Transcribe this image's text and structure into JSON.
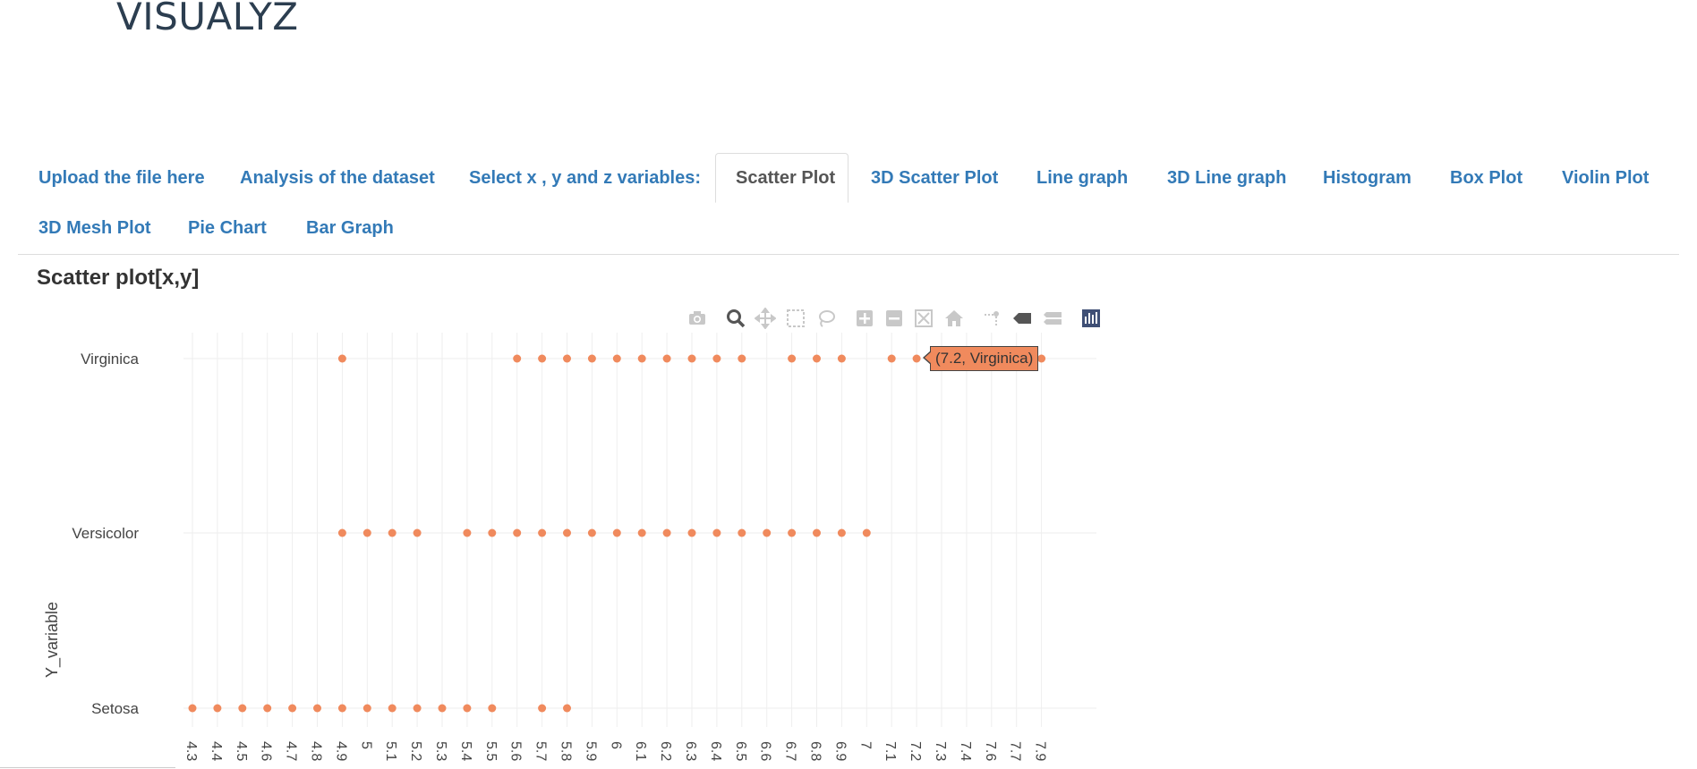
{
  "app": {
    "title": "VISUALYZ"
  },
  "tabs": [
    {
      "label": "Upload the file here",
      "active": false
    },
    {
      "label": "Analysis of the dataset",
      "active": false
    },
    {
      "label": "Select x , y and z variables:",
      "active": false
    },
    {
      "label": "Scatter Plot",
      "active": true
    },
    {
      "label": "3D Scatter Plot",
      "active": false
    },
    {
      "label": "Line graph",
      "active": false
    },
    {
      "label": "3D Line graph",
      "active": false
    },
    {
      "label": "Histogram",
      "active": false
    },
    {
      "label": "Box Plot",
      "active": false
    },
    {
      "label": "Violin Plot",
      "active": false
    },
    {
      "label": "3D Mesh Plot",
      "active": false
    },
    {
      "label": "Pie Chart",
      "active": false
    },
    {
      "label": "Bar Graph",
      "active": false
    }
  ],
  "section": {
    "title": "Scatter plot[x,y]"
  },
  "modebar": {
    "buttons": [
      {
        "icon": "camera-icon",
        "active": false
      },
      {
        "icon": "zoom-icon",
        "active": true
      },
      {
        "icon": "pan-icon",
        "active": false
      },
      {
        "icon": "box-select-icon",
        "active": false
      },
      {
        "icon": "lasso-select-icon",
        "active": false
      },
      {
        "icon": "zoom-in-icon",
        "active": false
      },
      {
        "icon": "zoom-out-icon",
        "active": false
      },
      {
        "icon": "autoscale-icon",
        "active": false
      },
      {
        "icon": "reset-axes-icon",
        "active": false
      },
      {
        "icon": "spike-lines-icon",
        "active": false
      },
      {
        "icon": "hover-closest-icon",
        "active": false
      },
      {
        "icon": "hover-compare-icon",
        "active": false
      },
      {
        "icon": "plotly-logo-icon",
        "active": false
      }
    ]
  },
  "tooltip": {
    "text": "(7.2, Virginica)"
  },
  "colors": {
    "marker": "#f08a5d",
    "tab_link": "#337ab7",
    "title": "#2c3e50",
    "grid": "#eeeeee"
  },
  "chart_data": {
    "type": "scatter",
    "title": "",
    "xlabel": "",
    "ylabel": "Y_variable",
    "categories_y": [
      "Setosa",
      "Versicolor",
      "Virginica"
    ],
    "x_ticks": [
      "4.3",
      "4.4",
      "4.5",
      "4.6",
      "4.7",
      "4.8",
      "4.9",
      "5",
      "5.1",
      "5.2",
      "5.3",
      "5.4",
      "5.5",
      "5.6",
      "5.7",
      "5.8",
      "5.9",
      "6",
      "6.1",
      "6.2",
      "6.3",
      "6.4",
      "6.5",
      "6.6",
      "6.7",
      "6.8",
      "6.9",
      "7",
      "7.1",
      "7.2",
      "7.3",
      "7.4",
      "7.6",
      "7.7",
      "7.9"
    ],
    "x_axis_type": "category",
    "grid": true,
    "series": [
      {
        "marker_color": "#f08a5d",
        "points": [
          {
            "x": "4.3",
            "y": "Setosa"
          },
          {
            "x": "4.4",
            "y": "Setosa"
          },
          {
            "x": "4.5",
            "y": "Setosa"
          },
          {
            "x": "4.6",
            "y": "Setosa"
          },
          {
            "x": "4.7",
            "y": "Setosa"
          },
          {
            "x": "4.8",
            "y": "Setosa"
          },
          {
            "x": "4.9",
            "y": "Setosa"
          },
          {
            "x": "5",
            "y": "Setosa"
          },
          {
            "x": "5.1",
            "y": "Setosa"
          },
          {
            "x": "5.2",
            "y": "Setosa"
          },
          {
            "x": "5.3",
            "y": "Setosa"
          },
          {
            "x": "5.4",
            "y": "Setosa"
          },
          {
            "x": "5.5",
            "y": "Setosa"
          },
          {
            "x": "5.7",
            "y": "Setosa"
          },
          {
            "x": "5.8",
            "y": "Setosa"
          },
          {
            "x": "4.9",
            "y": "Versicolor"
          },
          {
            "x": "5",
            "y": "Versicolor"
          },
          {
            "x": "5.1",
            "y": "Versicolor"
          },
          {
            "x": "5.2",
            "y": "Versicolor"
          },
          {
            "x": "5.4",
            "y": "Versicolor"
          },
          {
            "x": "5.5",
            "y": "Versicolor"
          },
          {
            "x": "5.6",
            "y": "Versicolor"
          },
          {
            "x": "5.7",
            "y": "Versicolor"
          },
          {
            "x": "5.8",
            "y": "Versicolor"
          },
          {
            "x": "5.9",
            "y": "Versicolor"
          },
          {
            "x": "6",
            "y": "Versicolor"
          },
          {
            "x": "6.1",
            "y": "Versicolor"
          },
          {
            "x": "6.2",
            "y": "Versicolor"
          },
          {
            "x": "6.3",
            "y": "Versicolor"
          },
          {
            "x": "6.4",
            "y": "Versicolor"
          },
          {
            "x": "6.5",
            "y": "Versicolor"
          },
          {
            "x": "6.6",
            "y": "Versicolor"
          },
          {
            "x": "6.7",
            "y": "Versicolor"
          },
          {
            "x": "6.8",
            "y": "Versicolor"
          },
          {
            "x": "6.9",
            "y": "Versicolor"
          },
          {
            "x": "7",
            "y": "Versicolor"
          },
          {
            "x": "4.9",
            "y": "Virginica"
          },
          {
            "x": "5.6",
            "y": "Virginica"
          },
          {
            "x": "5.7",
            "y": "Virginica"
          },
          {
            "x": "5.8",
            "y": "Virginica"
          },
          {
            "x": "5.9",
            "y": "Virginica"
          },
          {
            "x": "6",
            "y": "Virginica"
          },
          {
            "x": "6.1",
            "y": "Virginica"
          },
          {
            "x": "6.2",
            "y": "Virginica"
          },
          {
            "x": "6.3",
            "y": "Virginica"
          },
          {
            "x": "6.4",
            "y": "Virginica"
          },
          {
            "x": "6.5",
            "y": "Virginica"
          },
          {
            "x": "6.7",
            "y": "Virginica"
          },
          {
            "x": "6.8",
            "y": "Virginica"
          },
          {
            "x": "6.9",
            "y": "Virginica"
          },
          {
            "x": "7.1",
            "y": "Virginica"
          },
          {
            "x": "7.2",
            "y": "Virginica"
          },
          {
            "x": "7.9",
            "y": "Virginica"
          }
        ]
      }
    ]
  }
}
